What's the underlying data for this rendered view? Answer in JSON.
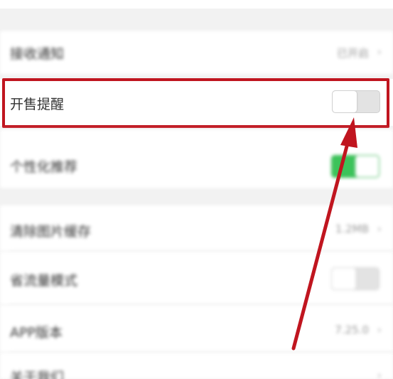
{
  "settings": {
    "blur_row_1": {
      "label": "接收通知",
      "value": "已开启"
    },
    "sale_reminder": {
      "label": "开售提醒",
      "enabled": false
    },
    "blur_row_3": {
      "label": "个性化推荐",
      "enabled": true
    },
    "blur_row_4": {
      "label": "清除图片缓存",
      "value": "1.2MB"
    },
    "blur_row_5": {
      "label": "省流量模式",
      "enabled": false
    },
    "blur_row_6": {
      "label": "APP版本",
      "value": "7.25.0"
    },
    "blur_row_7": {
      "label": "关于我们"
    }
  },
  "icons": {
    "chevron": "›"
  },
  "colors": {
    "highlight": "#c0151f",
    "toggle_on": "#3cc35a",
    "toggle_off": "#e3e3e3"
  }
}
